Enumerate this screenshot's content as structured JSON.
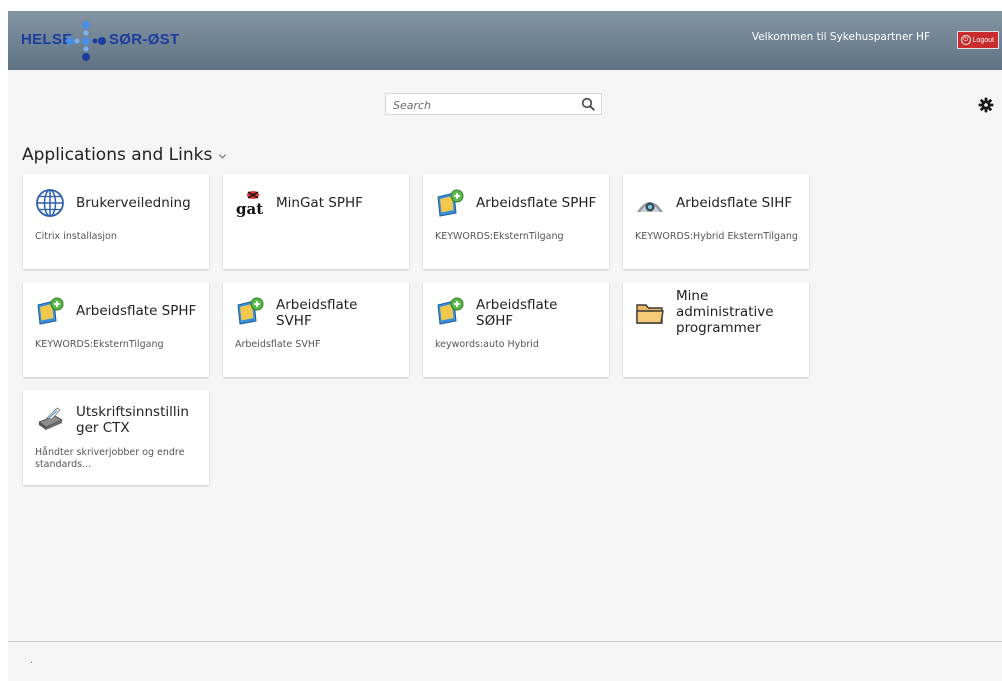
{
  "header": {
    "logo_left": "HELSE",
    "logo_right": "SØR-ØST",
    "welcome": "Velkommen til Sykehuspartner HF",
    "logout_label": "Logout"
  },
  "search": {
    "placeholder": "Search"
  },
  "section": {
    "title": "Applications and Links"
  },
  "cards": [
    {
      "title": "Brukerveiledning",
      "desc": "Citrix installasjon",
      "icon": "globe-icon"
    },
    {
      "title": "MinGat SPHF",
      "desc": "",
      "icon": "gat-logo-icon"
    },
    {
      "title": "Arbeidsflate SPHF",
      "desc": "KEYWORDS:EksternTilgang",
      "icon": "desktop-app-icon"
    },
    {
      "title": "Arbeidsflate SIHF",
      "desc": "KEYWORDS:Hybrid EksternTilgang",
      "icon": "eye-app-icon"
    },
    {
      "title": "Arbeidsflate SPHF",
      "desc": "KEYWORDS:EksternTilgang",
      "icon": "desktop-app-icon"
    },
    {
      "title": "Arbeidsflate SVHF",
      "desc": "Arbeidsflate SVHF",
      "icon": "desktop-app-icon"
    },
    {
      "title": "Arbeidsflate SØHF",
      "desc": "keywords:auto Hybrid",
      "icon": "desktop-app-icon"
    },
    {
      "title": "Mine administrative programmer",
      "desc": "",
      "icon": "folder-icon"
    },
    {
      "title": "Utskriftsinnstillinger CTX",
      "desc": "Håndter skriverjobber og endre standards...",
      "icon": "printer-icon"
    }
  ],
  "footer": {
    "text": "."
  },
  "colors": {
    "header_top": "#8496a4",
    "header_bottom": "#5f7282",
    "logo_blue": "#1b3d9e",
    "dot_blue": "#4b8ee6",
    "logout_red": "#c82c2c"
  }
}
